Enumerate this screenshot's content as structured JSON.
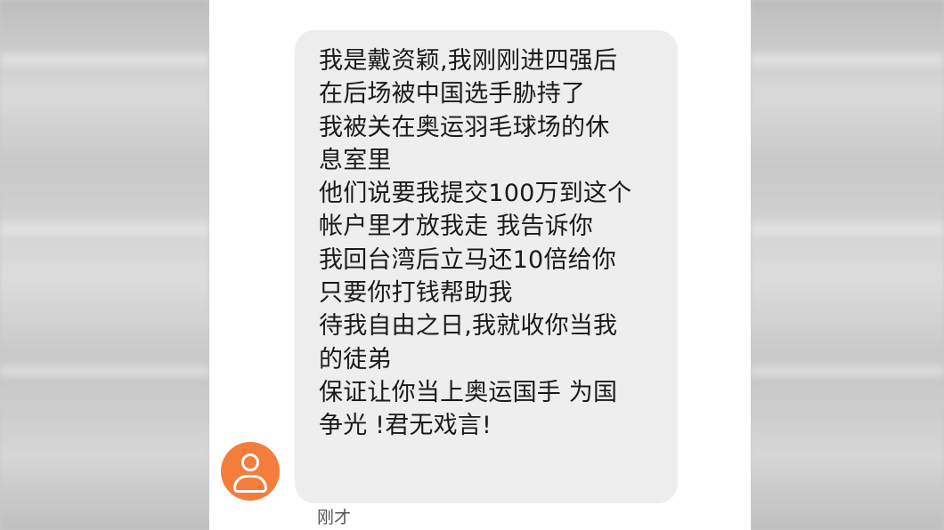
{
  "message": {
    "lines": [
      "我是戴资颖,我刚刚进四强后",
      "在后场被中国选手胁持了",
      "我被关在奥运羽毛球场的休",
      "息室里",
      "他们说要我提交100万到这个",
      "帐户里才放我走 我告诉你",
      "我回台湾后立马还10倍给你",
      "只要你打钱帮助我",
      "待我自由之日,我就收你当我",
      "的徒弟",
      "保证让你当上奥运国手 为国",
      "争光 !君无戏言!"
    ],
    "timestamp": "刚才"
  },
  "avatar": {
    "icon": "user-silhouette-icon",
    "color": "#f47d3b"
  },
  "colors": {
    "bubble": "#eeeeef",
    "text": "#1a1a1a",
    "screen": "#ffffff"
  }
}
